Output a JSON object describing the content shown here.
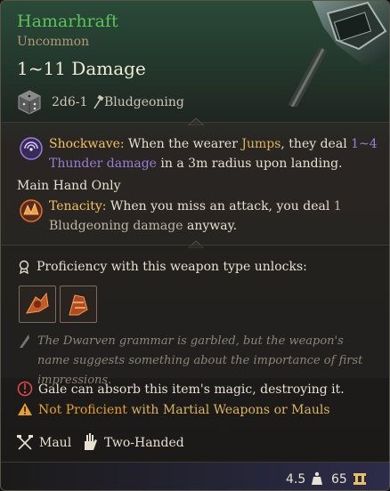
{
  "item": {
    "name": "Hamarhraft",
    "rarity": "Uncommon",
    "damage_total": "1~11 Damage",
    "damage_formula": "2d6-1",
    "damage_type": "Bludgeoning"
  },
  "abilities": {
    "shockwave": {
      "title": "Shockwave:",
      "text_a": " When the wearer ",
      "jumps": "Jumps",
      "text_b": ", they deal ",
      "amount": "1~4",
      "thunder": "Thunder damage",
      "text_c": " in a 3m radius upon landing."
    },
    "main_hand_only": "Main Hand Only",
    "tenacity": {
      "title": "Tenacity:",
      "text_a": " When you miss an attack, you deal ",
      "amount": "1",
      "bludgeoning": "Bludgeoning damage",
      "text_b": " anyway."
    }
  },
  "proficiency": {
    "unlocks_label": "Proficiency with this weapon type unlocks:"
  },
  "flavor": "The Dwarven grammar is garbled, but the weapon's name suggests something about the importance of first impressions.",
  "notes": {
    "gale": "Gale can absorb this item's magic, destroying it.",
    "not_proficient": "Not Proficient",
    "not_proficient_detail": " with Martial Weapons or Mauls"
  },
  "properties": {
    "weapon_type": "Maul",
    "handedness": "Two-Handed"
  },
  "footer": {
    "weight": "4.5",
    "value": "65"
  },
  "colors": {
    "name_green": "#59c45a",
    "rarity": "#b59a72",
    "keyword_gold": "#dcb45c",
    "thunder_purple": "#9a7ed8",
    "warning_orange": "#e8a02a"
  },
  "icons": [
    "die-icon",
    "bludgeon-icon",
    "shockwave-icon",
    "tenacity-icon",
    "proficiency-icon",
    "unlock-slot-1",
    "unlock-slot-2",
    "quill-icon",
    "gale-icon",
    "warning-icon",
    "maul-icon",
    "two-handed-icon",
    "weight-icon",
    "gold-icon"
  ]
}
